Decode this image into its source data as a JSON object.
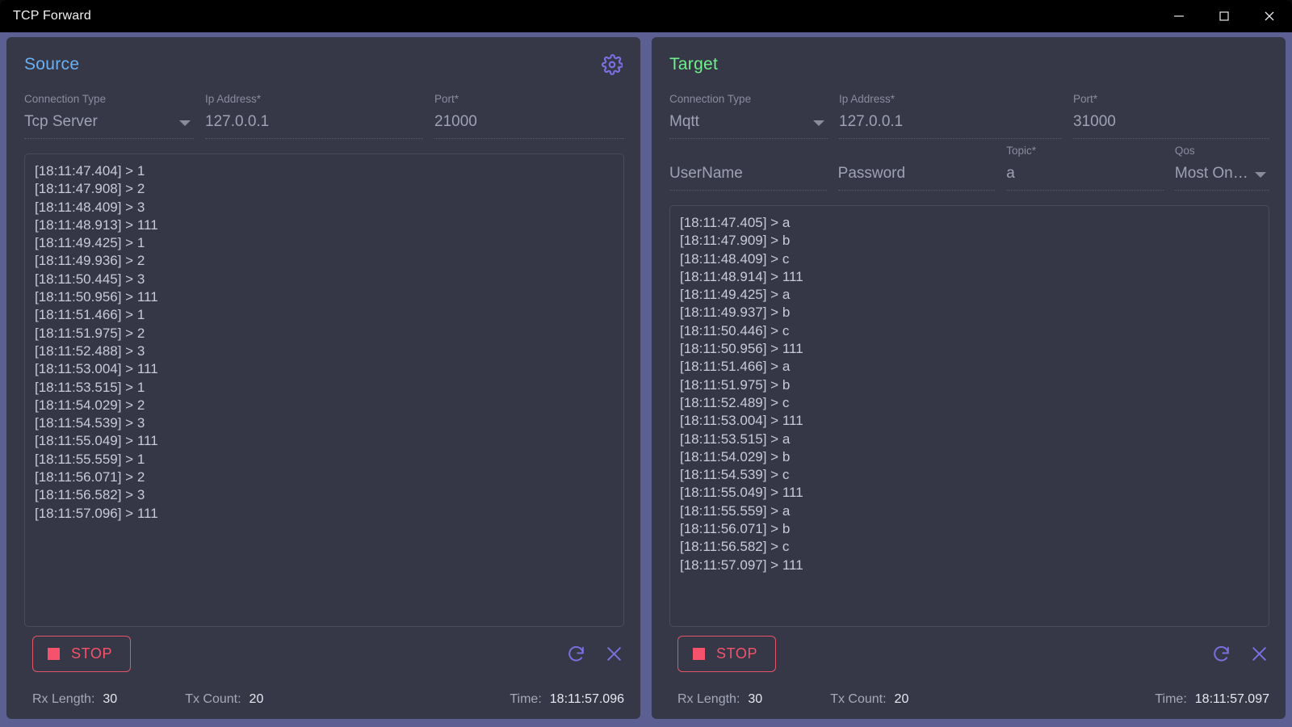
{
  "window": {
    "title": "TCP Forward",
    "controls": {
      "minimize": "minimize-icon",
      "maximize": "maximize-icon",
      "close": "close-icon"
    }
  },
  "source": {
    "title": "Source",
    "gear_icon": "gear-icon",
    "fields": {
      "connection_type": {
        "label": "Connection Type",
        "value": "Tcp Server"
      },
      "ip_address": {
        "label": "Ip Address*",
        "value": "127.0.0.1"
      },
      "port": {
        "label": "Port*",
        "value": "21000"
      }
    },
    "log_lines": [
      "[18:11:47.404] > 1",
      "[18:11:47.908] > 2",
      "[18:11:48.409] > 3",
      "[18:11:48.913] > 111",
      "[18:11:49.425] > 1",
      "[18:11:49.936] > 2",
      "[18:11:50.445] > 3",
      "[18:11:50.956] > 111",
      "[18:11:51.466] > 1",
      "[18:11:51.975] > 2",
      "[18:11:52.488] > 3",
      "[18:11:53.004] > 111",
      "[18:11:53.515] > 1",
      "[18:11:54.029] > 2",
      "[18:11:54.539] > 3",
      "[18:11:55.049] > 111",
      "[18:11:55.559] > 1",
      "[18:11:56.071] > 2",
      "[18:11:56.582] > 3",
      "[18:11:57.096] > 111"
    ],
    "toolbar": {
      "stop_label": "STOP",
      "refresh_icon": "refresh-icon",
      "clear_icon": "close-icon"
    },
    "status": {
      "rx_label": "Rx Length:",
      "rx_value": "30",
      "tx_label": "Tx Count:",
      "tx_value": "20",
      "time_label": "Time:",
      "time_value": "18:11:57.096"
    }
  },
  "target": {
    "title": "Target",
    "fields": {
      "connection_type": {
        "label": "Connection Type",
        "value": "Mqtt"
      },
      "ip_address": {
        "label": "Ip Address*",
        "value": "127.0.0.1"
      },
      "port": {
        "label": "Port*",
        "value": "31000"
      },
      "username": {
        "label": "",
        "value": "UserName"
      },
      "password": {
        "label": "",
        "value": "Password"
      },
      "topic": {
        "label": "Topic*",
        "value": "a"
      },
      "qos": {
        "label": "Qos",
        "value": "Most Once"
      }
    },
    "log_lines": [
      "[18:11:47.405] > a",
      "[18:11:47.909] > b",
      "[18:11:48.409] > c",
      "[18:11:48.914] > 111",
      "[18:11:49.425] > a",
      "[18:11:49.937] > b",
      "[18:11:50.446] > c",
      "[18:11:50.956] > 111",
      "[18:11:51.466] > a",
      "[18:11:51.975] > b",
      "[18:11:52.489] > c",
      "[18:11:53.004] > 111",
      "[18:11:53.515] > a",
      "[18:11:54.029] > b",
      "[18:11:54.539] > c",
      "[18:11:55.049] > 111",
      "[18:11:55.559] > a",
      "[18:11:56.071] > b",
      "[18:11:56.582] > c",
      "[18:11:57.097] > 111"
    ],
    "toolbar": {
      "stop_label": "STOP",
      "refresh_icon": "refresh-icon",
      "clear_icon": "close-icon"
    },
    "status": {
      "rx_label": "Rx Length:",
      "rx_value": "30",
      "tx_label": "Tx Count:",
      "tx_value": "20",
      "time_label": "Time:",
      "time_value": "18:11:57.097"
    }
  },
  "colors": {
    "window_border": "#5b5f91",
    "panel_bg": "#363847",
    "source_accent": "#6ab0f3",
    "target_accent": "#6ef08a",
    "stop_red": "#f4536b",
    "icon_purple": "#7b6fe0",
    "titlebar_bg": "#000000"
  }
}
